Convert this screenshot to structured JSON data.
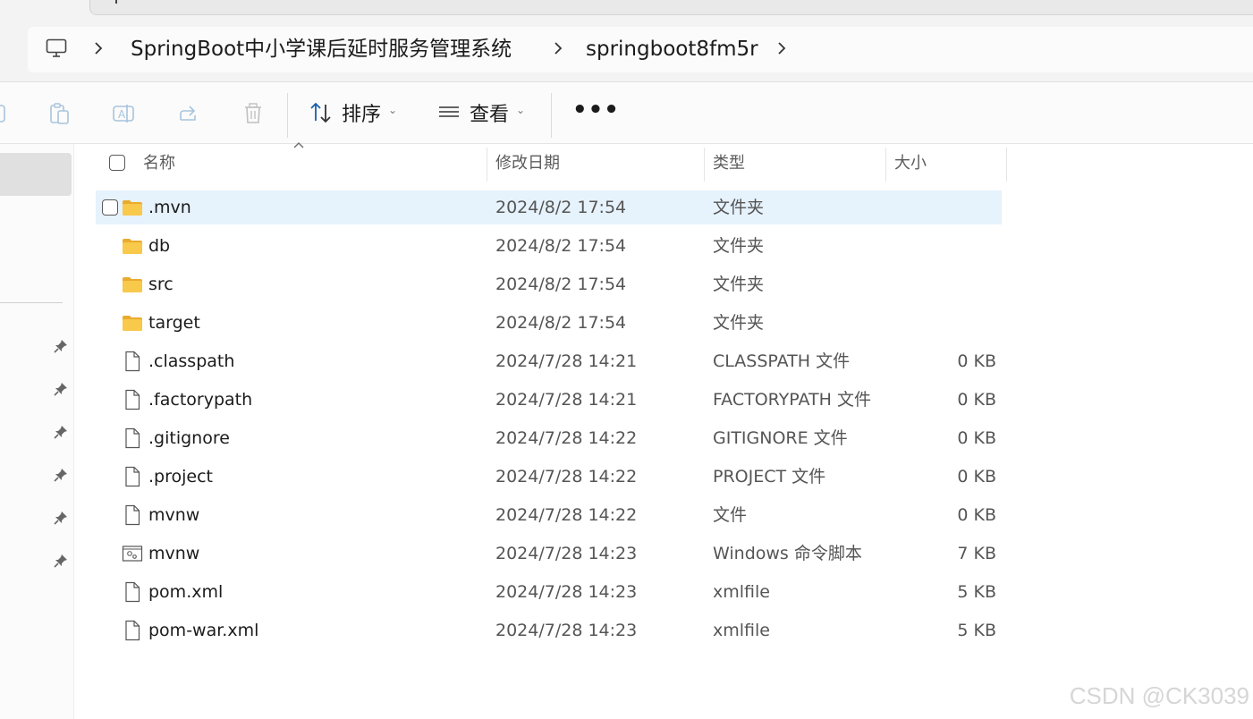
{
  "address": {
    "crumbs": [
      "SpringBoot中小学课后延时服务管理系统",
      "springboot8fm5r"
    ]
  },
  "toolbar": {
    "sort_label": "排序",
    "view_label": "查看",
    "more_label": "•••"
  },
  "columns": {
    "name": "名称",
    "modified": "修改日期",
    "type": "类型",
    "size": "大小"
  },
  "files": [
    {
      "name": ".mvn",
      "date": "2024/8/2 17:54",
      "type": "文件夹",
      "size": "",
      "icon": "folder-icon",
      "selected": true
    },
    {
      "name": "db",
      "date": "2024/8/2 17:54",
      "type": "文件夹",
      "size": "",
      "icon": "folder-icon"
    },
    {
      "name": "src",
      "date": "2024/8/2 17:54",
      "type": "文件夹",
      "size": "",
      "icon": "folder-icon"
    },
    {
      "name": "target",
      "date": "2024/8/2 17:54",
      "type": "文件夹",
      "size": "",
      "icon": "folder-icon"
    },
    {
      "name": ".classpath",
      "date": "2024/7/28 14:21",
      "type": "CLASSPATH 文件",
      "size": "0 KB",
      "icon": "file-icon"
    },
    {
      "name": ".factorypath",
      "date": "2024/7/28 14:21",
      "type": "FACTORYPATH 文件",
      "size": "0 KB",
      "icon": "file-icon"
    },
    {
      "name": ".gitignore",
      "date": "2024/7/28 14:22",
      "type": "GITIGNORE 文件",
      "size": "0 KB",
      "icon": "file-icon"
    },
    {
      "name": ".project",
      "date": "2024/7/28 14:22",
      "type": "PROJECT 文件",
      "size": "0 KB",
      "icon": "file-icon"
    },
    {
      "name": "mvnw",
      "date": "2024/7/28 14:22",
      "type": "文件",
      "size": "0 KB",
      "icon": "file-icon"
    },
    {
      "name": "mvnw",
      "date": "2024/7/28 14:23",
      "type": "Windows 命令脚本",
      "size": "7 KB",
      "icon": "script-file-icon"
    },
    {
      "name": "pom.xml",
      "date": "2024/7/28 14:23",
      "type": "xmlfile",
      "size": "5 KB",
      "icon": "file-icon"
    },
    {
      "name": "pom-war.xml",
      "date": "2024/7/28 14:23",
      "type": "xmlfile",
      "size": "5 KB",
      "icon": "file-icon"
    }
  ],
  "watermark": "CSDN @CK3039",
  "colors": {
    "selected_row": "#e6f2fc",
    "folder": "#f8c94a",
    "nav_selected": "#e0e0e0"
  }
}
